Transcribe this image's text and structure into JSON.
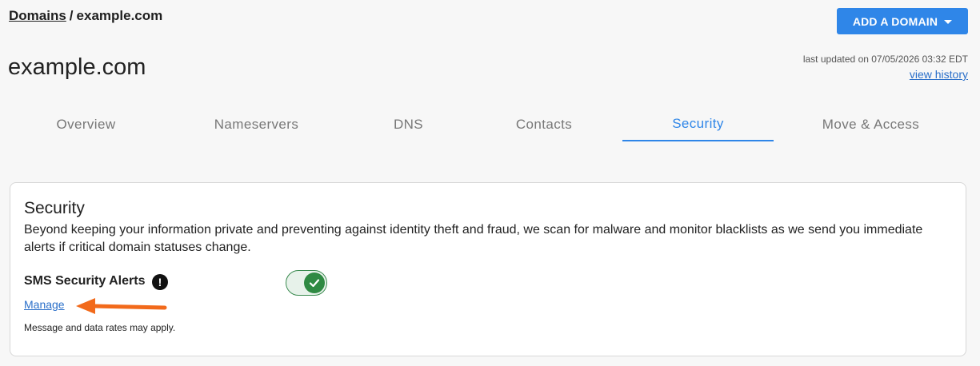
{
  "breadcrumb": {
    "root": "Domains",
    "separator": "/",
    "current": "example.com"
  },
  "header": {
    "add_domain_label": "ADD A DOMAIN",
    "page_title": "example.com",
    "last_updated": "last updated on 07/05/2026 03:32 EDT",
    "view_history": "view history"
  },
  "tabs": [
    {
      "label": "Overview",
      "active": false
    },
    {
      "label": "Nameservers",
      "active": false
    },
    {
      "label": "DNS",
      "active": false
    },
    {
      "label": "Contacts",
      "active": false
    },
    {
      "label": "Security",
      "active": true
    },
    {
      "label": "Move & Access",
      "active": false
    }
  ],
  "security": {
    "title": "Security",
    "description": "Beyond keeping your information private and preventing against identity theft and fraud, we scan for malware and monitor blacklists as we send you immediate alerts if critical domain statuses change.",
    "sms_label": "SMS Security Alerts",
    "info_icon": "!",
    "toggle_on": true,
    "manage_label": "Manage",
    "disclaimer": "Message and data rates may apply."
  },
  "colors": {
    "accent": "#2f86e8",
    "link": "#2a6fc9",
    "toggle_on": "#2f8a43",
    "annotation_arrow": "#f26a1b"
  },
  "icons": [
    "chevron-down-icon",
    "info-icon",
    "checkmark-icon",
    "arrow-left-icon"
  ]
}
